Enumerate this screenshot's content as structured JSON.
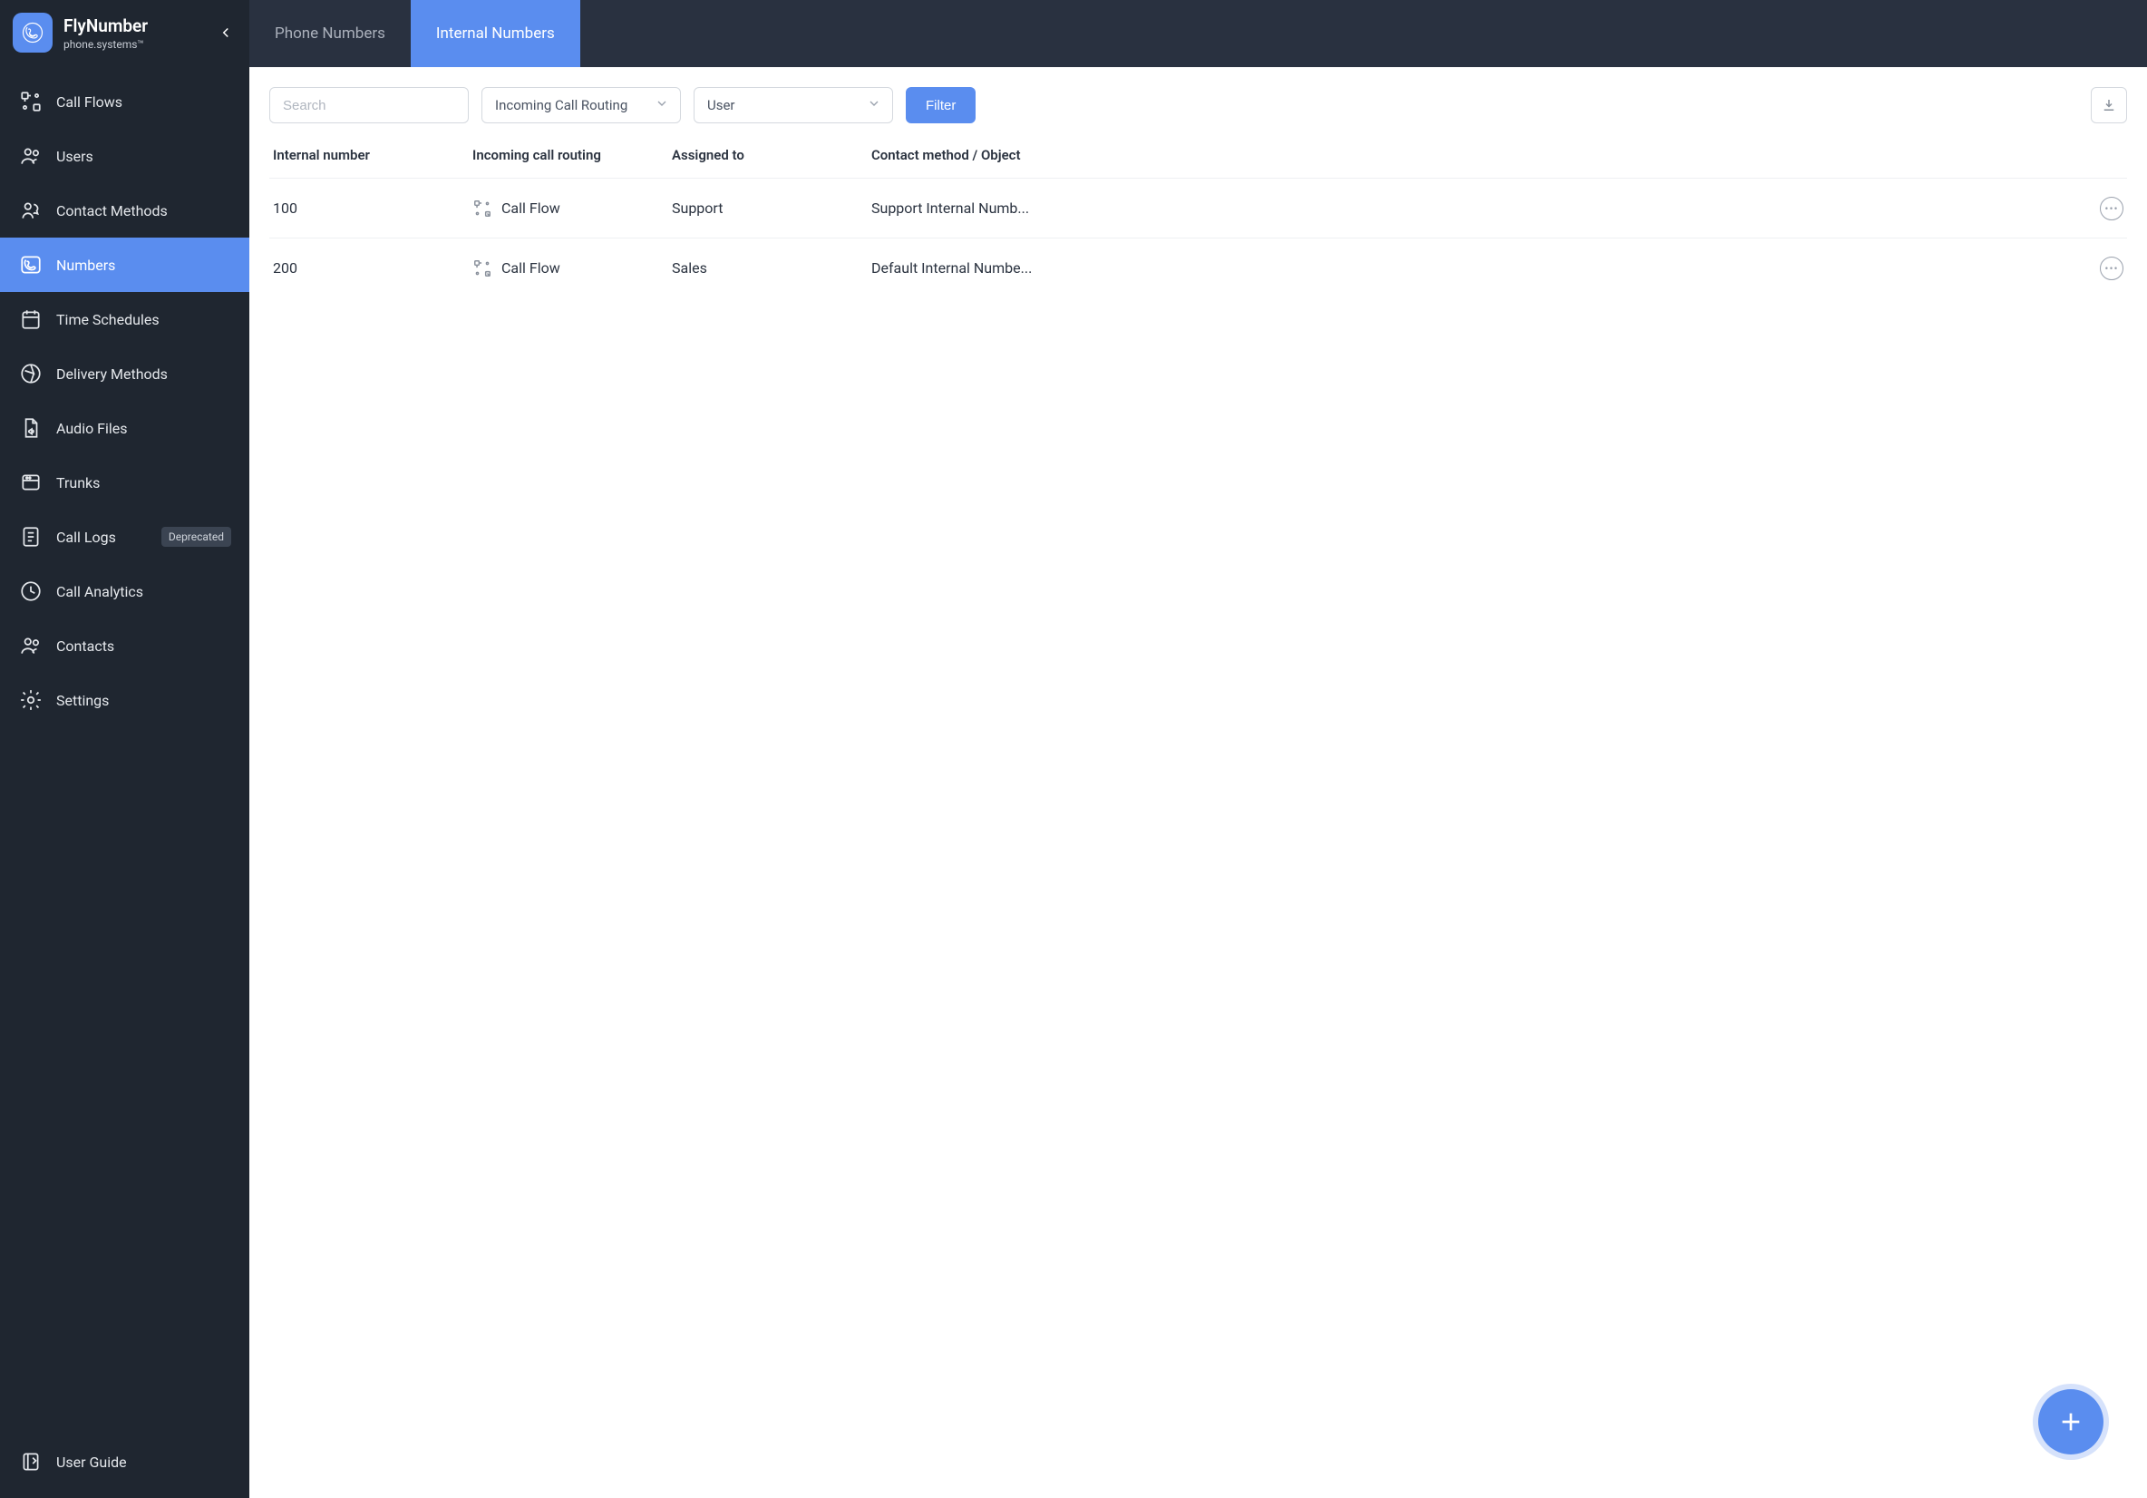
{
  "brand": {
    "title": "FlyNumber",
    "subtitle": "phone.systems™"
  },
  "sidebar": {
    "items": [
      {
        "label": "Call Flows",
        "icon": "callflows-icon"
      },
      {
        "label": "Users",
        "icon": "users-icon"
      },
      {
        "label": "Contact Methods",
        "icon": "contact-methods-icon"
      },
      {
        "label": "Numbers",
        "icon": "numbers-icon",
        "active": true
      },
      {
        "label": "Time Schedules",
        "icon": "calendar-icon"
      },
      {
        "label": "Delivery Methods",
        "icon": "delivery-icon"
      },
      {
        "label": "Audio Files",
        "icon": "audio-icon"
      },
      {
        "label": "Trunks",
        "icon": "trunks-icon"
      },
      {
        "label": "Call Logs",
        "icon": "calllogs-icon",
        "badge": "Deprecated"
      },
      {
        "label": "Call Analytics",
        "icon": "analytics-icon"
      },
      {
        "label": "Contacts",
        "icon": "contacts-icon"
      },
      {
        "label": "Settings",
        "icon": "settings-icon"
      }
    ],
    "footer": {
      "label": "User Guide",
      "icon": "guide-icon"
    }
  },
  "tabs": [
    {
      "label": "Phone Numbers",
      "active": false
    },
    {
      "label": "Internal Numbers",
      "active": true
    }
  ],
  "filters": {
    "search_placeholder": "Search",
    "routing_label": "Incoming Call Routing",
    "user_label": "User",
    "filter_button": "Filter"
  },
  "table": {
    "headers": {
      "number": "Internal number",
      "routing": "Incoming call routing",
      "assigned": "Assigned to",
      "object": "Contact method / Object"
    },
    "rows": [
      {
        "number": "100",
        "routing": "Call Flow",
        "assigned": "Support",
        "object": "Support Internal Numb..."
      },
      {
        "number": "200",
        "routing": "Call Flow",
        "assigned": "Sales",
        "object": "Default Internal Numbe..."
      }
    ]
  }
}
